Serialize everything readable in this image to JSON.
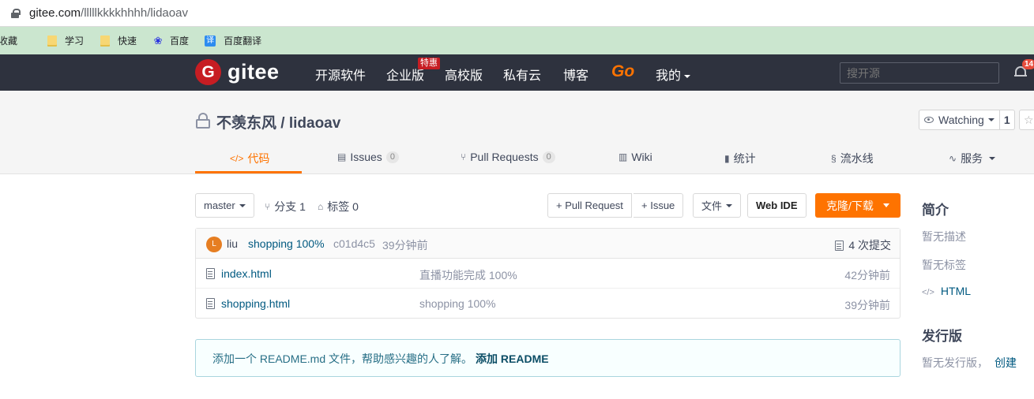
{
  "browser": {
    "url_host": "gitee.com",
    "url_path": "/lllllkkkkhhhh/lidaoav",
    "bookmarks": [
      {
        "label": "收藏",
        "icon": "none"
      },
      {
        "label": "学习",
        "icon": "folder-icon"
      },
      {
        "label": "快速",
        "icon": "folder-icon"
      },
      {
        "label": "百度",
        "icon": "baidu-paw-icon"
      },
      {
        "label": "百度翻译",
        "icon": "translate-icon"
      }
    ]
  },
  "header": {
    "brand": "gitee",
    "nav": [
      "开源软件",
      "企业版",
      "高校版",
      "私有云",
      "博客"
    ],
    "badge": "特惠",
    "go": "Go",
    "mine": "我的",
    "search_placeholder": "搜开源",
    "notification_count": "14"
  },
  "project": {
    "title": "不羡东风 / lidaoav",
    "watching_label": "Watching",
    "watching_count": "1",
    "tabs": [
      {
        "icon": "</>",
        "label": "代码",
        "count": ""
      },
      {
        "icon": "▤",
        "label": "Issues",
        "count": "0"
      },
      {
        "icon": "⑂",
        "label": "Pull Requests",
        "count": "0"
      },
      {
        "icon": "▥",
        "label": "Wiki",
        "count": ""
      },
      {
        "icon": "▮",
        "label": "统计",
        "count": ""
      },
      {
        "icon": "§",
        "label": "流水线",
        "count": ""
      },
      {
        "icon": "∿",
        "label": "服务",
        "count": ""
      }
    ]
  },
  "toolbar": {
    "branch": "master",
    "branches": "分支 1",
    "tags": "标签 0",
    "pull_request": "+ Pull Request",
    "issue": "+ Issue",
    "file_menu": "文件",
    "web_ide": "Web IDE",
    "clone": "克隆/下载"
  },
  "commit": {
    "avatar_letter": "L",
    "author": "liu",
    "message": "shopping 100%",
    "hash": "c01d4c5",
    "time": "39分钟前",
    "count": "4 次提交"
  },
  "files": [
    {
      "name": "index.html",
      "message": "直播功能完成 100%",
      "time": "42分钟前"
    },
    {
      "name": "shopping.html",
      "message": "shopping 100%",
      "time": "39分钟前"
    }
  ],
  "readme_notice": {
    "text": "添加一个 README.md 文件，帮助感兴趣的人了解。",
    "link": "添加 README"
  },
  "sidebar": {
    "intro_title": "简介",
    "no_description": "暂无描述",
    "no_tags": "暂无标签",
    "language": "HTML",
    "release_title": "发行版",
    "no_release": "暂无发行版，",
    "create": "创建"
  },
  "colors": {
    "header_bg": "#2e323e",
    "accent_orange": "#fe7300",
    "brand_red": "#c71d23",
    "link_blue": "#005980"
  }
}
